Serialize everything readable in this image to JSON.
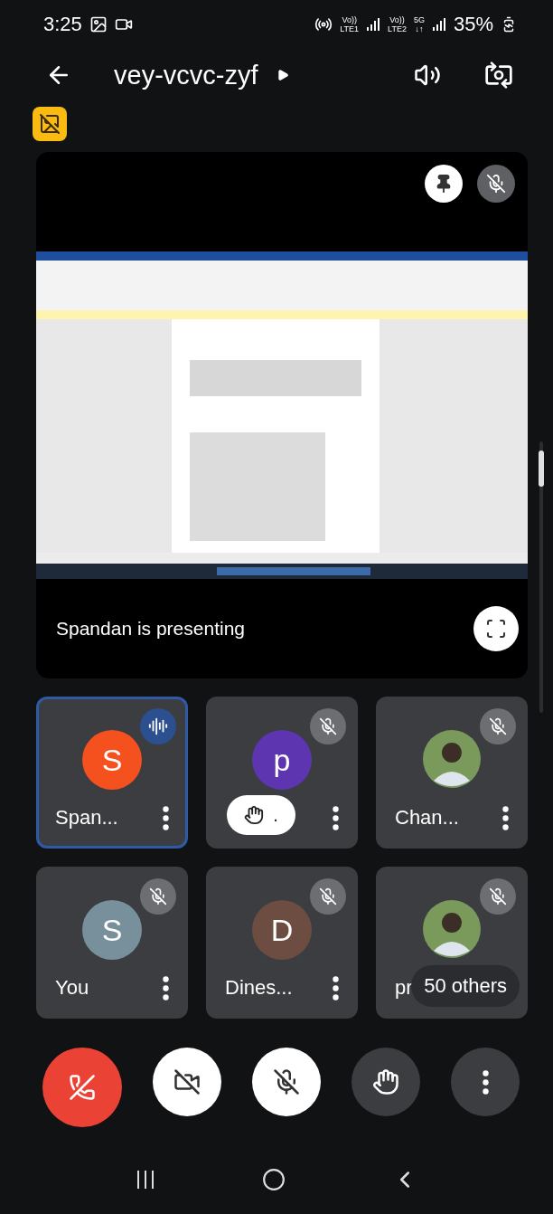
{
  "status_bar": {
    "time": "3:25",
    "indicators": [
      {
        "top": "Vo))",
        "bottom": "LTE1"
      },
      {
        "top": "Vo))",
        "bottom": "LTE2"
      },
      {
        "top": "5G",
        "bottom": "↓↑"
      }
    ],
    "battery": "35%"
  },
  "top_bar": {
    "meeting_code": "vey-vcvc-zyf"
  },
  "presentation": {
    "kind": "picture",
    "caption": "Spandan is presenting"
  },
  "tiles": [
    {
      "name": "Span...",
      "initial": "S",
      "kind": "letter",
      "color": "#f4511e",
      "speaking": true,
      "selected": true
    },
    {
      "initial": "p",
      "kind": "letter",
      "color": "#5e35b1",
      "speaking": false,
      "selected": false,
      "hand": "."
    },
    {
      "name": "Chan...",
      "speaking": false,
      "selected": false
    },
    {
      "name": "You",
      "initial": "S",
      "kind": "letter",
      "color": "#78909c",
      "speaking": false,
      "selected": false
    },
    {
      "name": "Dines...",
      "initial": "D",
      "kind": "letter",
      "color": "#6d4c41",
      "speaking": false,
      "selected": false
    },
    {
      "name": "pr",
      "speaking": false,
      "selected": false,
      "overflow": "50 others"
    }
  ],
  "controls": [
    {
      "kind": "end"
    },
    {
      "kind": "camera",
      "on": false
    },
    {
      "kind": "mic",
      "on": false
    },
    {
      "kind": "hand"
    },
    {
      "kind": "more"
    }
  ]
}
